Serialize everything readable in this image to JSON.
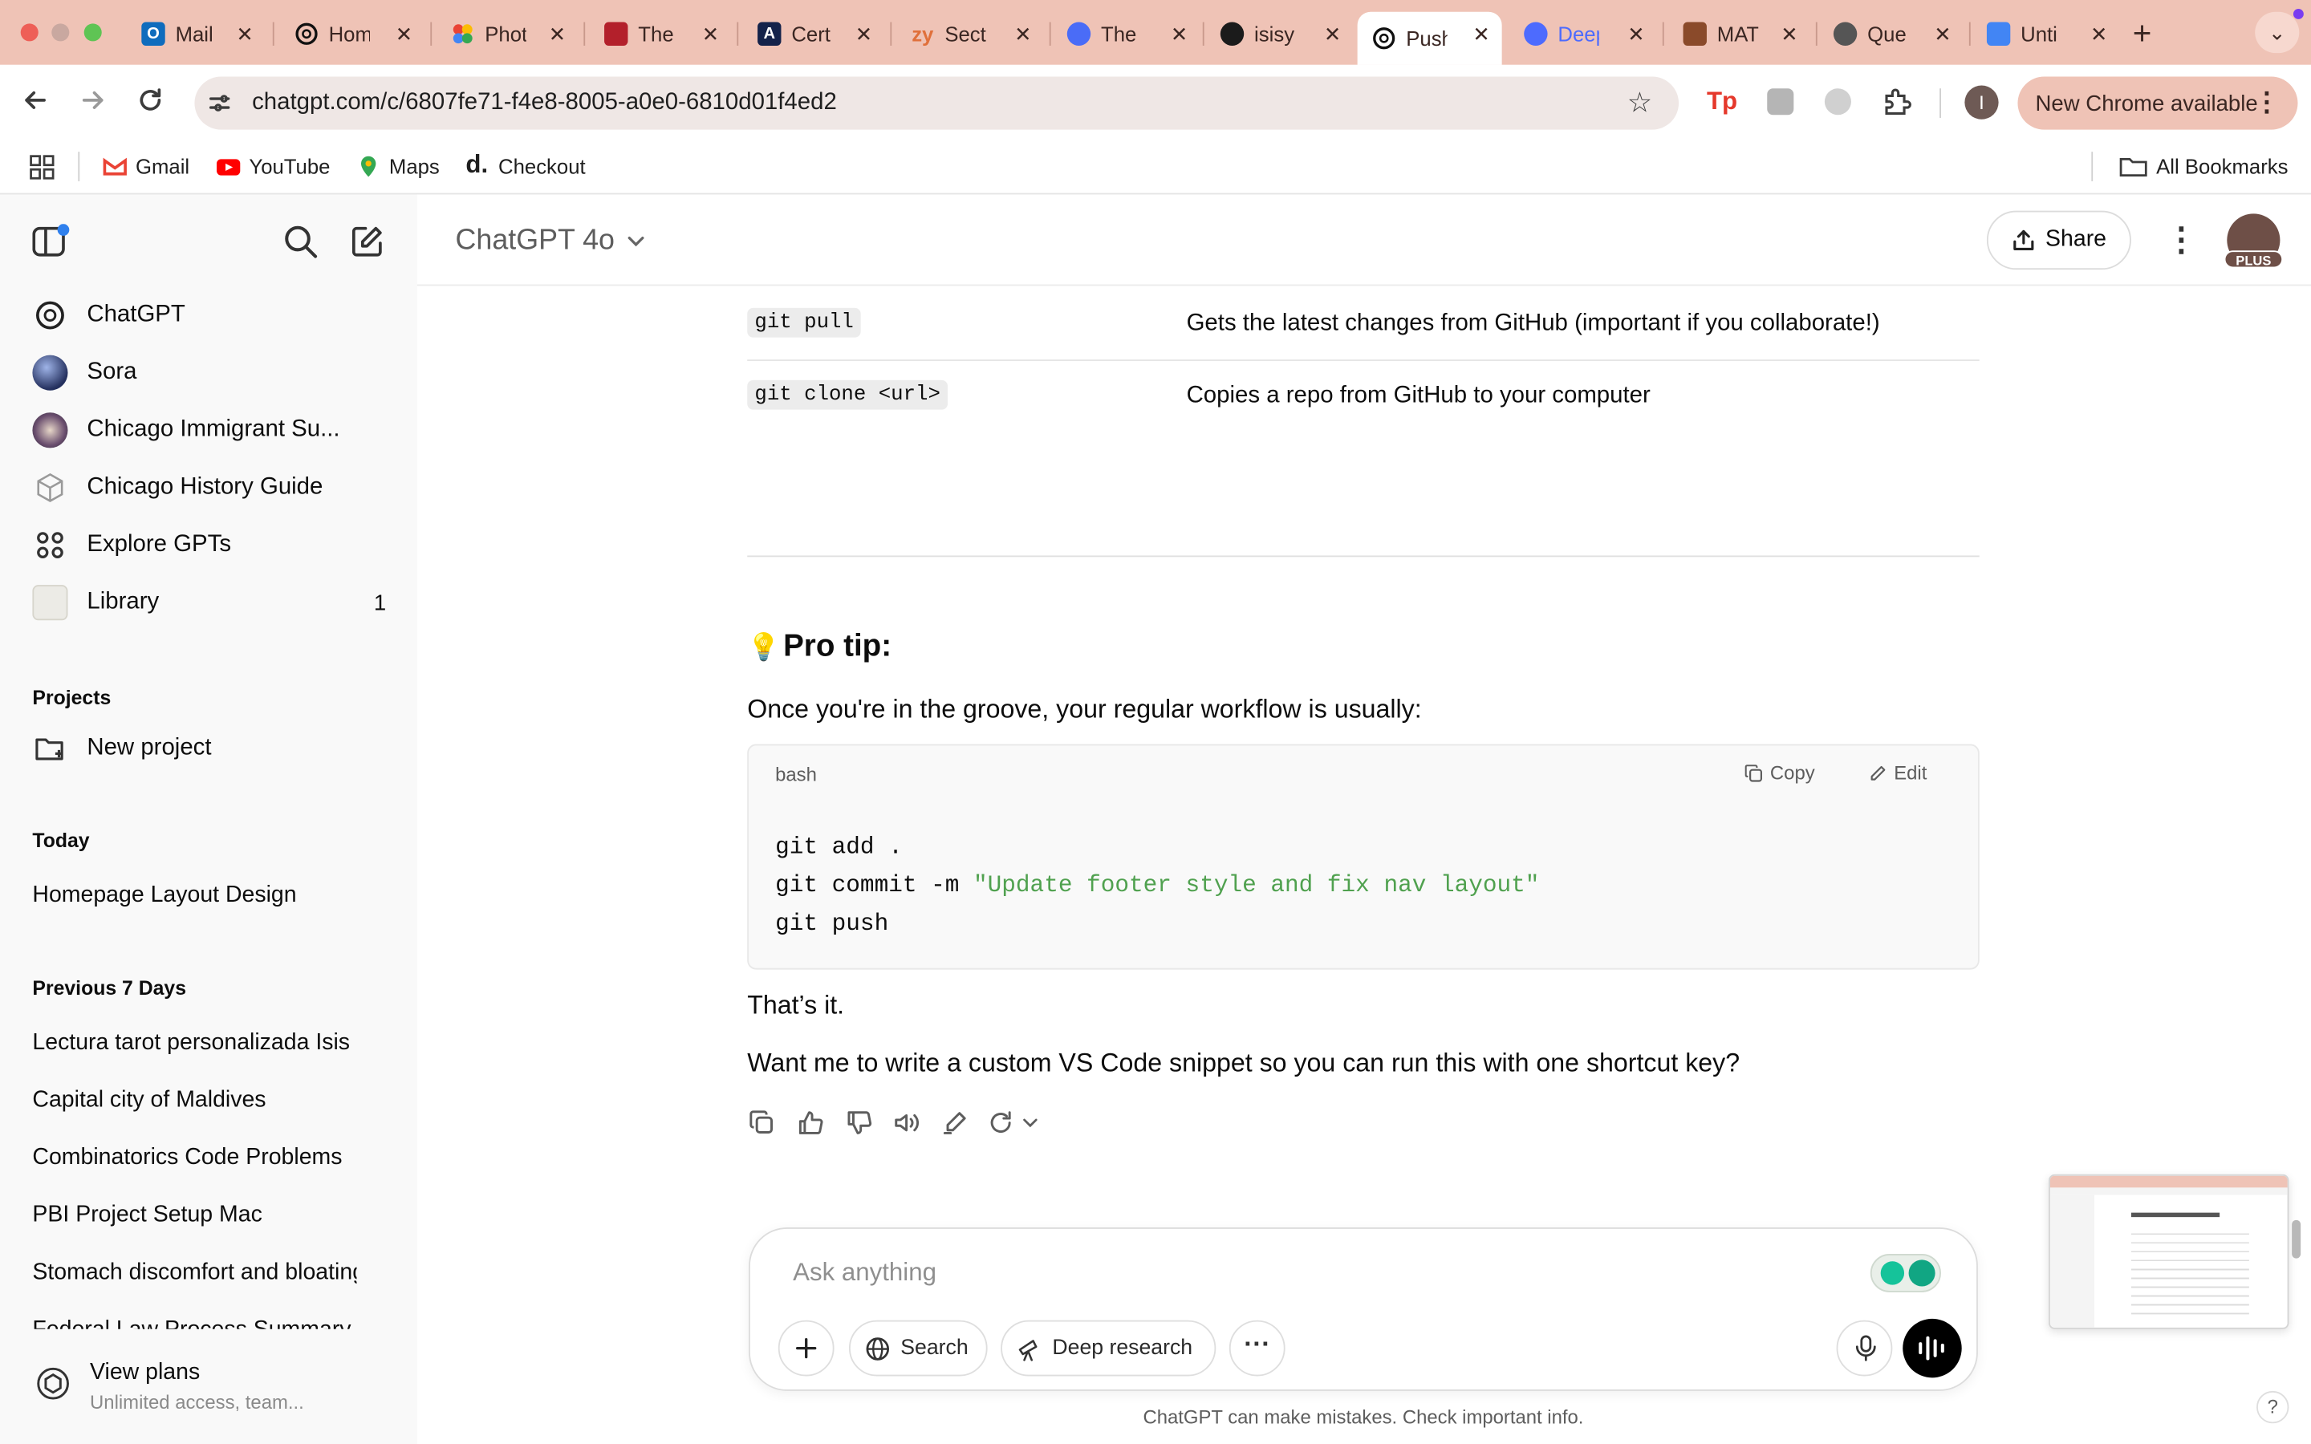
{
  "browser": {
    "tabs": [
      {
        "title": "Mail",
        "icon": "outlook-icon"
      },
      {
        "title": "Hom",
        "icon": "openai-icon"
      },
      {
        "title": "Phot",
        "icon": "photos-icon"
      },
      {
        "title": "The",
        "icon": "book-icon"
      },
      {
        "title": "Cert",
        "icon": "cert-icon"
      },
      {
        "title": "Sect",
        "icon": "zybooks-icon"
      },
      {
        "title": "The",
        "icon": "app-icon"
      },
      {
        "title": "isisy",
        "icon": "github-icon"
      },
      {
        "title": "Push",
        "icon": "openai-icon"
      },
      {
        "title": "Deep",
        "icon": "deepseek-icon"
      },
      {
        "title": "MAT",
        "icon": "mat-icon"
      },
      {
        "title": "Que",
        "icon": "globe-icon"
      },
      {
        "title": "Unti",
        "icon": "docs-icon"
      }
    ],
    "url": "chatgpt.com/c/6807fe71-f4e8-8005-a0e0-6810d01f4ed2",
    "update_label": "New Chrome available",
    "profile_initial": "I",
    "bookmarks": [
      {
        "label": "Gmail",
        "icon": "gmail-icon"
      },
      {
        "label": "YouTube",
        "icon": "youtube-icon"
      },
      {
        "label": "Maps",
        "icon": "maps-icon"
      },
      {
        "label": "Checkout",
        "icon": "d-icon"
      }
    ],
    "all_bookmarks": "All Bookmarks"
  },
  "sidebar": {
    "items": [
      {
        "label": "ChatGPT"
      },
      {
        "label": "Sora"
      },
      {
        "label": "Chicago Immigrant Su..."
      },
      {
        "label": "Chicago History Guide"
      },
      {
        "label": "Explore GPTs"
      },
      {
        "label": "Library",
        "badge": "1"
      }
    ],
    "projects_heading": "Projects",
    "new_project": "New project",
    "today_heading": "Today",
    "today_chats": [
      "Homepage Layout Design"
    ],
    "prev7_heading": "Previous 7 Days",
    "prev7_chats": [
      "Lectura tarot personalizada Isis",
      "Capital city of Maldives",
      "Combinatorics Code Problems",
      "PBI Project Setup Mac",
      "Stomach discomfort and bloating",
      "Federal Law Process Summary"
    ],
    "plans_title": "View plans",
    "plans_sub": "Unlimited access, team..."
  },
  "header": {
    "model": "ChatGPT 4o",
    "share": "Share",
    "plan_badge": "PLUS"
  },
  "conversation": {
    "table_rows": [
      {
        "cmd": "git pull",
        "desc": "Gets the latest changes from GitHub (important if you collaborate!)"
      },
      {
        "cmd": "git clone <url>",
        "desc": "Copies a repo from GitHub to your computer"
      }
    ],
    "protip_emoji": "💡",
    "protip_title": "Pro tip:",
    "protip_text": "Once you're in the groove, your regular workflow is usually:",
    "code_lang": "bash",
    "copy": "Copy",
    "edit": "Edit",
    "code_line1": "git add .",
    "code_line2_a": "git commit -m ",
    "code_line2_b": "\"Update footer style and fix nav layout\"",
    "code_line3": "git push",
    "thats_it": "That’s it.",
    "followup": "Want me to write a custom VS Code snippet so you can run this with one shortcut key?"
  },
  "composer": {
    "placeholder": "Ask anything",
    "search": "Search",
    "deep_research": "Deep research",
    "disclaimer": "ChatGPT can make mistakes. Check important info."
  },
  "help": "?"
}
